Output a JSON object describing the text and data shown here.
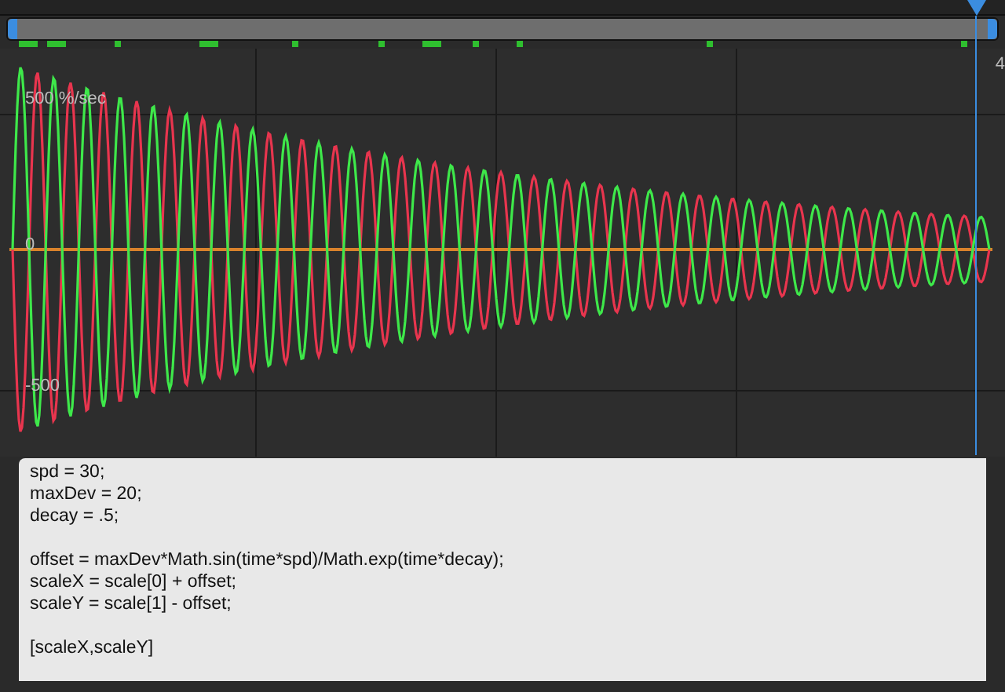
{
  "graph": {
    "labels": [
      {
        "kind": "top",
        "text": "500 %/sec"
      },
      {
        "kind": "zero",
        "text": "0"
      },
      {
        "kind": "bottom",
        "text": "-500"
      }
    ],
    "edge_label": "4"
  },
  "expression": {
    "blocks": [
      [
        "spd = 30;",
        "maxDev = 20;",
        "decay = .5;"
      ],
      [
        "offset = maxDev*Math.sin(time*spd)/Math.exp(time*decay);",
        "scaleX = scale[0] + offset;",
        "scaleY = scale[1] - offset;"
      ],
      [
        "[scaleX,scaleY]"
      ]
    ]
  }
}
